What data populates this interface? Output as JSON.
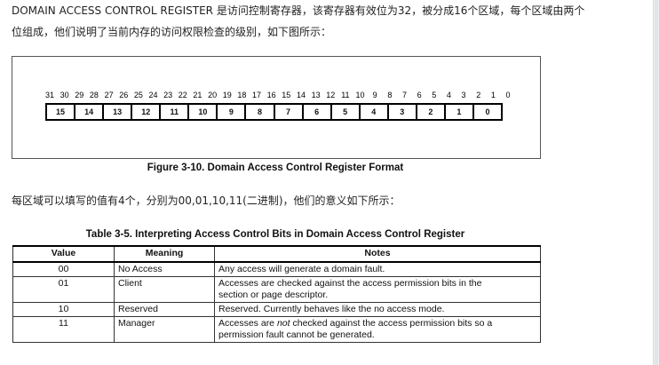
{
  "intro": {
    "line1": "DOMAIN ACCESS CONTROL REGISTER 是访问控制寄存器，该寄存器有效位为32，被分成16个区域，每个区域由两个",
    "line2": "位组成，他们说明了当前内存的访问权限检查的级别，如下图所示："
  },
  "figure": {
    "bit_numbers": [
      "31",
      "30",
      "29",
      "28",
      "27",
      "26",
      "25",
      "24",
      "23",
      "22",
      "21",
      "20",
      "19",
      "18",
      "17",
      "16",
      "15",
      "14",
      "13",
      "12",
      "11",
      "10",
      "9",
      "8",
      "7",
      "6",
      "5",
      "4",
      "3",
      "2",
      "1",
      "0"
    ],
    "fields": [
      "15",
      "14",
      "13",
      "12",
      "11",
      "10",
      "9",
      "8",
      "7",
      "6",
      "5",
      "4",
      "3",
      "2",
      "1",
      "0"
    ],
    "caption": "Figure 3-10. Domain Access Control Register Format"
  },
  "para2": "每区域可以填写的值有4个，分别为00,01,10,11(二进制)，他们的意义如下所示：",
  "table": {
    "caption": "Table 3-5. Interpreting Access Control Bits in Domain Access Control Register",
    "headers": [
      "Value",
      "Meaning",
      "Notes"
    ],
    "rows": [
      {
        "value": "00",
        "meaning": "No Access",
        "notes": "Any access will generate a domain fault."
      },
      {
        "value": "01",
        "meaning": "Client",
        "notes_line1": "Accesses are checked against the access permission bits in the",
        "notes_line2": "section or page descriptor."
      },
      {
        "value": "10",
        "meaning": "Reserved",
        "notes": "Reserved. Currently behaves like the no access mode."
      },
      {
        "value": "11",
        "meaning": "Manager",
        "notes_pre": "Accesses are ",
        "notes_em": "not",
        "notes_post": " checked against the access permission bits so a",
        "notes_line2": "permission fault cannot be generated."
      }
    ]
  }
}
